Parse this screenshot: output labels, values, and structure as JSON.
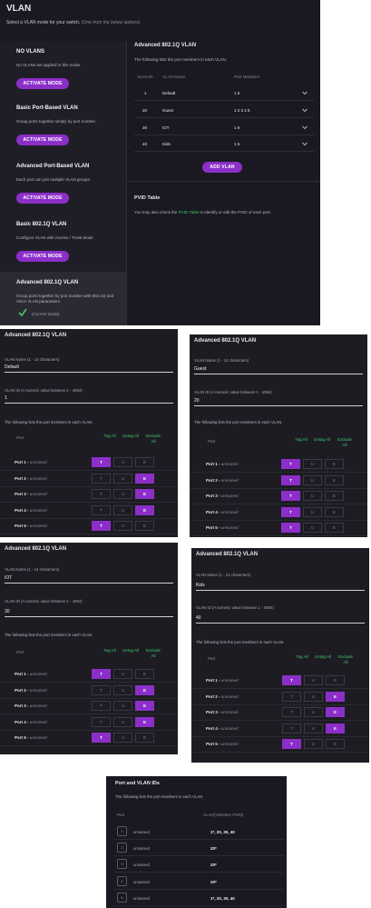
{
  "main": {
    "title": "VLAN",
    "subtitle": "Select a VLAN mode for your switch.",
    "subtitle_hint": "(One from the below options)",
    "modes": [
      {
        "name": "NO VLANS",
        "desc": "No VLANs are applied in this mode.",
        "button": "ACTIVATE MODE"
      },
      {
        "name": "Basic Port-Based VLAN",
        "desc": "Group ports together simply by port number.",
        "button": "ACTIVATE MODE"
      },
      {
        "name": "Advanced Port-Based VLAN",
        "desc": "Each port can join multiple VLAN groups.",
        "button": "ACTIVATE MODE"
      },
      {
        "name": "Basic 802.1Q VLAN",
        "desc": "Configure VLAN with Access / Trunk Mode",
        "button": "ACTIVATE MODE"
      },
      {
        "name": "Advanced 802.1Q VLAN",
        "desc": "Group ports together by port number with 802.1Q and Voice VLAN parameters.",
        "status": "(Current Mode)"
      }
    ],
    "section_title": "Advanced 802.1Q VLAN",
    "section_desc": "The following lists the port members in each VLAN.",
    "table_headers": {
      "id": "VLAN ID",
      "name": "VLAN Name",
      "members": "Port Members"
    },
    "vlans": [
      {
        "id": "1",
        "name": "Default",
        "members": "1 5"
      },
      {
        "id": "20",
        "name": "Guest",
        "members": "1 2 3 4 5"
      },
      {
        "id": "30",
        "name": "IOT",
        "members": "1 5"
      },
      {
        "id": "40",
        "name": "Kids",
        "members": "1 5"
      }
    ],
    "add_button": "ADD VLAN",
    "pvid_title": "PVID Table",
    "pvid_desc_pre": "You may also check the",
    "pvid_link": "PVID Table",
    "pvid_desc_post": "to identify or edit the PVID of each port."
  },
  "details": [
    {
      "title": "Advanced 802.1Q VLAN",
      "name_label": "VLAN Name (1 - 14 characters)",
      "name_value": "Default",
      "id_label": "VLAN ID (A numeric value between 1 - 4094)",
      "id_value": "1",
      "table_desc": "The following lists the port members in each VLAN.",
      "col_port": "Port",
      "col_tag": "Tag All",
      "col_untag": "Untag All",
      "col_excl": "Exclude All",
      "ports": [
        {
          "label": "Port 1",
          "sub": "unnamed",
          "state": "T"
        },
        {
          "label": "Port 2",
          "sub": "unnamed",
          "state": "E"
        },
        {
          "label": "Port 3",
          "sub": "unnamed",
          "state": "E"
        },
        {
          "label": "Port 4",
          "sub": "unnamed",
          "state": "E"
        },
        {
          "label": "Port 5",
          "sub": "unnamed",
          "state": "T"
        }
      ]
    },
    {
      "title": "Advanced 802.1Q VLAN",
      "name_label": "VLAN Name (1 - 14 characters)",
      "name_value": "Guest",
      "id_label": "VLAN ID (A numeric value between 1 - 4094)",
      "id_value": "20",
      "table_desc": "The following lists the port members in each VLAN.",
      "col_port": "Port",
      "col_tag": "Tag All",
      "col_untag": "Untag All",
      "col_excl": "Exclude All",
      "ports": [
        {
          "label": "Port 1",
          "sub": "unnamed",
          "state": "T"
        },
        {
          "label": "Port 2",
          "sub": "unnamed",
          "state": "T"
        },
        {
          "label": "Port 3",
          "sub": "unnamed",
          "state": "T"
        },
        {
          "label": "Port 4",
          "sub": "unnamed",
          "state": "T"
        },
        {
          "label": "Port 5",
          "sub": "unnamed",
          "state": "T"
        }
      ]
    },
    {
      "title": "Advanced 802.1Q VLAN",
      "name_label": "VLAN Name (1 - 14 characters)",
      "name_value": "IOT",
      "id_label": "VLAN ID (A numeric value between 1 - 4094)",
      "id_value": "30",
      "table_desc": "The following lists the port members in each VLAN.",
      "col_port": "Port",
      "col_tag": "Tag All",
      "col_untag": "Untag All",
      "col_excl": "Exclude All",
      "ports": [
        {
          "label": "Port 1",
          "sub": "unnamed",
          "state": "T"
        },
        {
          "label": "Port 2",
          "sub": "unnamed",
          "state": "E"
        },
        {
          "label": "Port 3",
          "sub": "unnamed",
          "state": "E"
        },
        {
          "label": "Port 4",
          "sub": "unnamed",
          "state": "E"
        },
        {
          "label": "Port 5",
          "sub": "unnamed",
          "state": "T"
        }
      ]
    },
    {
      "title": "Advanced 802.1Q VLAN",
      "name_label": "VLAN Name (1 - 14 characters)",
      "name_value": "Kids",
      "id_label": "VLAN ID (A numeric value between 1 - 4094)",
      "id_value": "40",
      "table_desc": "The following lists the port members in each VLAN.",
      "col_port": "Port",
      "col_tag": "Tag All",
      "col_untag": "Untag All",
      "col_excl": "Exclude All",
      "ports": [
        {
          "label": "Port 1",
          "sub": "unnamed",
          "state": "T"
        },
        {
          "label": "Port 2",
          "sub": "unnamed",
          "state": "E"
        },
        {
          "label": "Port 3",
          "sub": "unnamed",
          "state": "E"
        },
        {
          "label": "Port 4",
          "sub": "unnamed",
          "state": "E"
        },
        {
          "label": "Port 5",
          "sub": "unnamed",
          "state": "T"
        }
      ]
    }
  ],
  "pvid": {
    "title": "Port and VLAN IDs",
    "desc": "The following lists the port members in each VLAN.",
    "col_port": "Port",
    "col_vlan": "VLAN(*denotes PVID)",
    "rows": [
      {
        "num": "1",
        "name": "unnamed",
        "vlans": "1*, 20, 30, 40"
      },
      {
        "num": "2",
        "name": "unnamed",
        "vlans": "20*"
      },
      {
        "num": "3",
        "name": "unnamed",
        "vlans": "20*"
      },
      {
        "num": "4",
        "name": "unnamed",
        "vlans": "20*"
      },
      {
        "num": "5",
        "name": "unnamed",
        "vlans": "1*, 20, 30, 40"
      }
    ]
  },
  "colors": {
    "accent": "#8c2fc9",
    "link": "#3fc86a",
    "panel_bg": "#1d1c23"
  },
  "icons": {
    "chevron": "chevron-down-icon",
    "check": "check-icon"
  }
}
